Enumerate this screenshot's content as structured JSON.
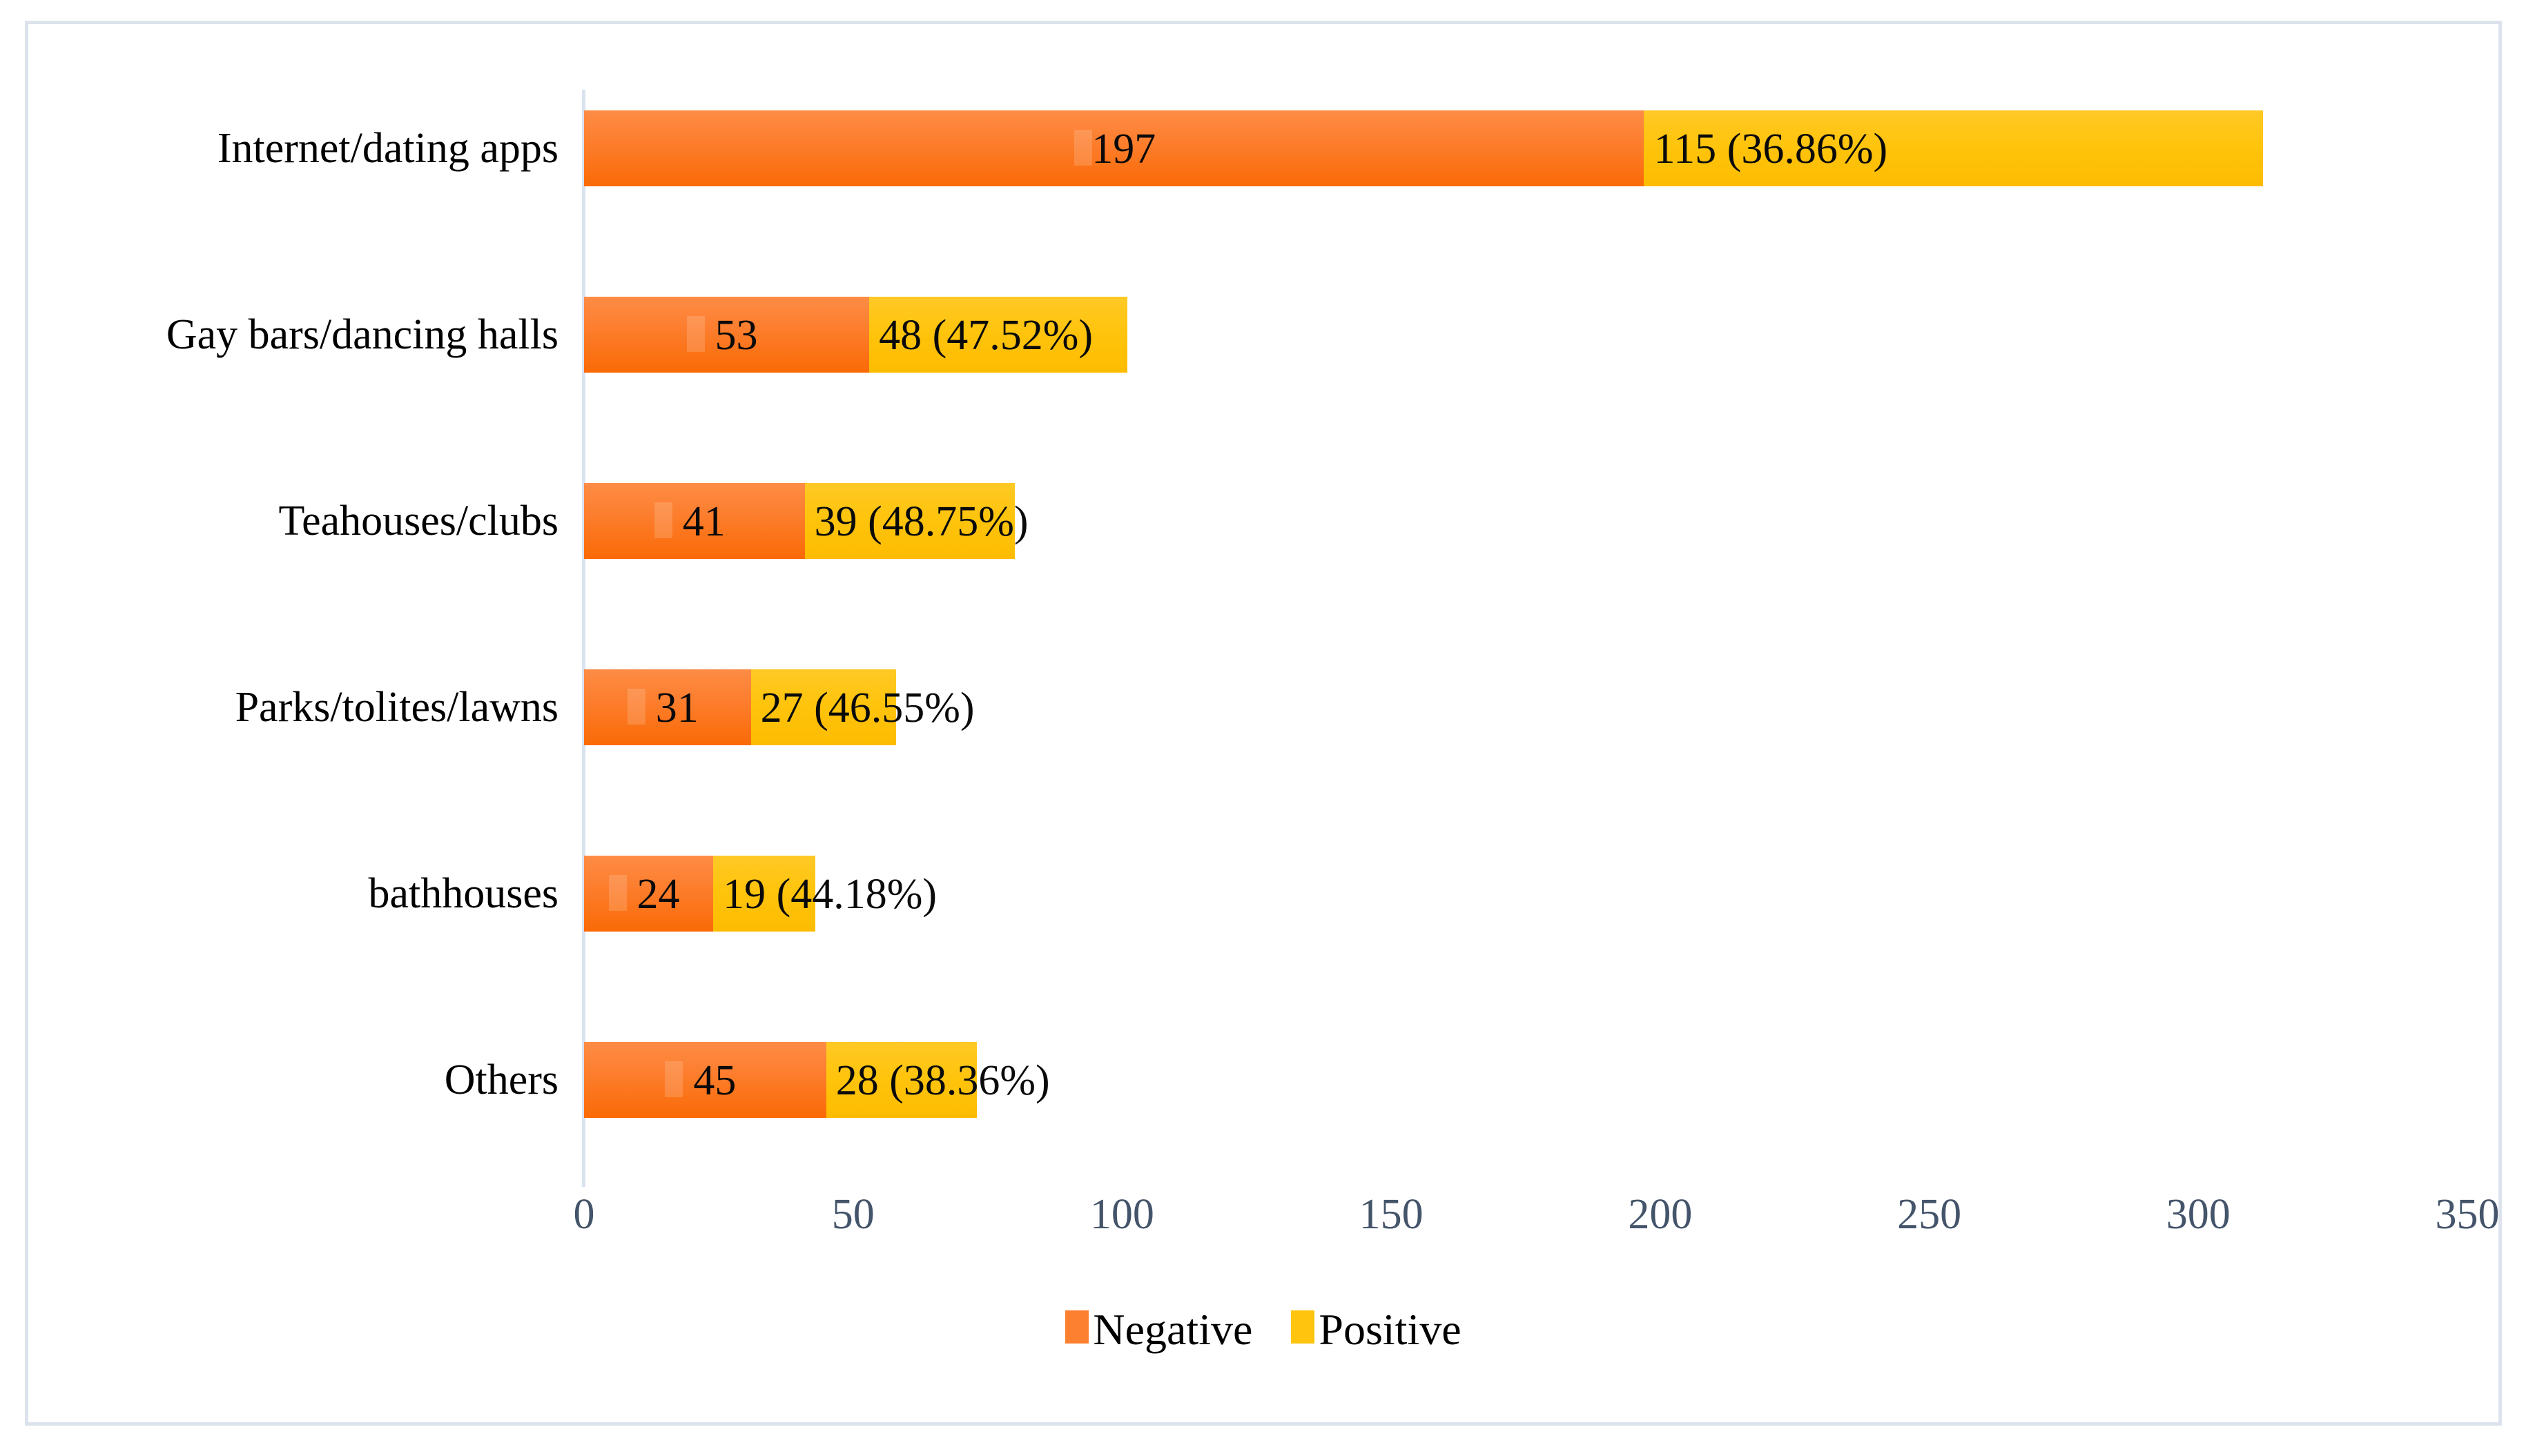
{
  "chart_data": {
    "type": "bar",
    "orientation": "horizontal",
    "stacked": true,
    "title": "",
    "xlabel": "",
    "ylabel": "",
    "xlim": [
      0,
      350
    ],
    "xticks": [
      "0",
      "50",
      "100",
      "150",
      "200",
      "250",
      "300",
      "350"
    ],
    "grid": false,
    "legend_position": "bottom",
    "categories": [
      "Internet/dating apps",
      "Gay bars/dancing halls",
      "Teahouses/clubs",
      "Parks/tolites/lawns",
      "bathhouses",
      "Others"
    ],
    "series": [
      {
        "name": "Negative",
        "color": "#FD7F30",
        "values": [
          197,
          53,
          41,
          31,
          24,
          45
        ],
        "labels": [
          "197",
          "53",
          "41",
          "31",
          "24",
          "45"
        ]
      },
      {
        "name": "Positive",
        "color": "#FFC40D",
        "values": [
          115,
          48,
          39,
          27,
          19,
          28
        ],
        "labels": [
          "115 (36.86%)",
          "48 (47.52%)",
          "39 (48.75%)",
          "27 (46.55%)",
          "19 (44.18%)",
          "28 (38.36%)"
        ]
      }
    ],
    "totals": [
      312,
      101,
      80,
      58,
      43,
      73
    ]
  },
  "legend": {
    "items": [
      {
        "label": "Negative",
        "color": "#FD7F30"
      },
      {
        "label": "Positive",
        "color": "#FFC40D"
      }
    ]
  },
  "axis": {
    "tick_color": "#44546A",
    "axis_line_color": "#D9E2EF"
  },
  "frame": {
    "border_color": "#DCE3EC",
    "background": "#FFFFFF"
  }
}
